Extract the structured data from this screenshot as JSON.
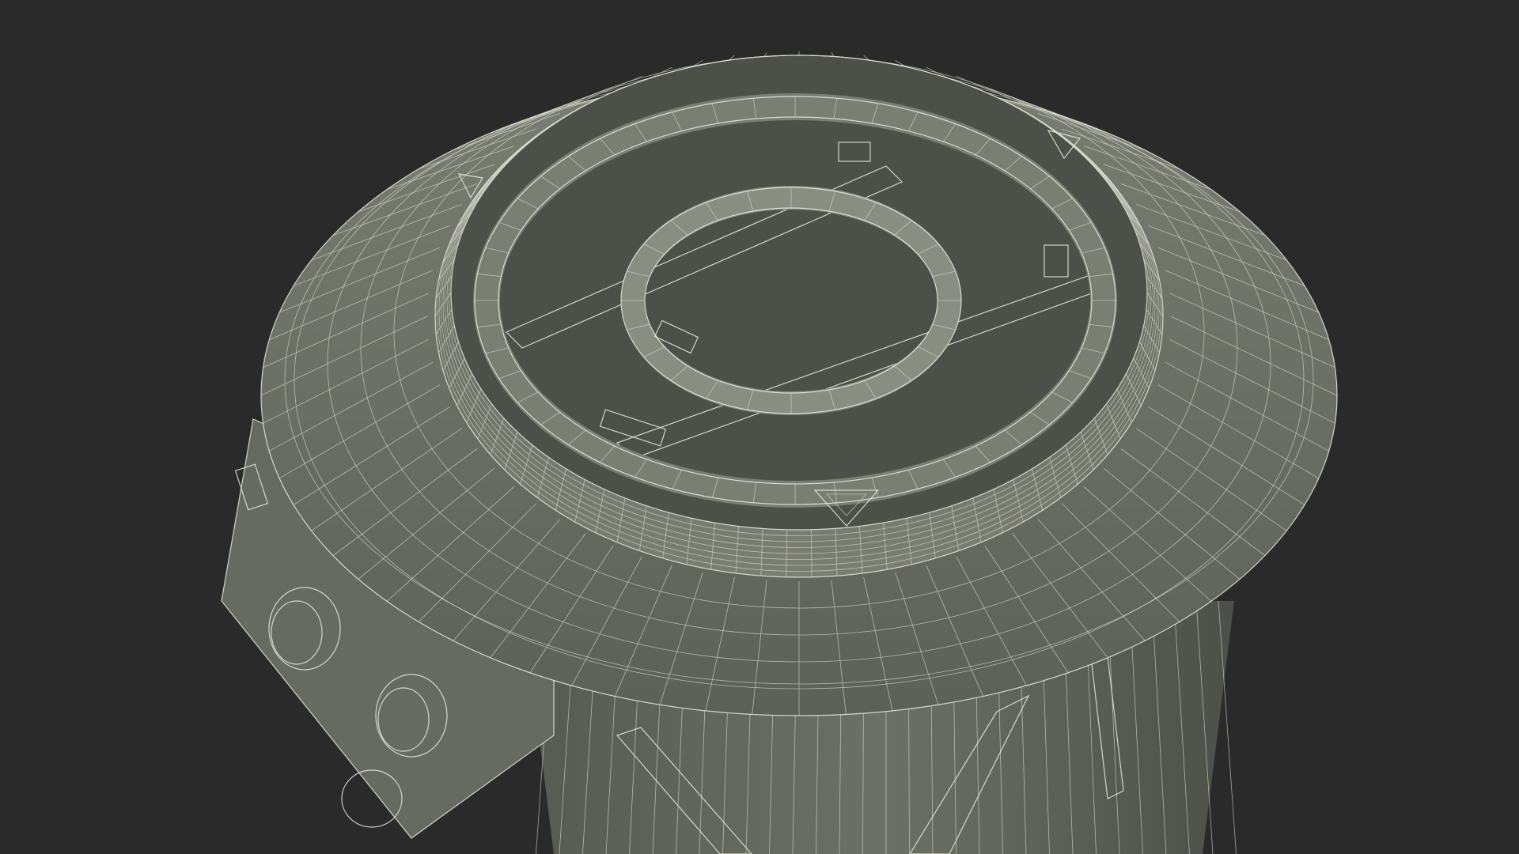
{
  "scene": {
    "subject": "wireframe-render",
    "colors": {
      "background": "#2a2a2a",
      "surface_dark": "#4f524a",
      "surface_mid": "#6e7167",
      "surface_light": "#8a8d82",
      "wire": "#e9ebdc"
    }
  }
}
